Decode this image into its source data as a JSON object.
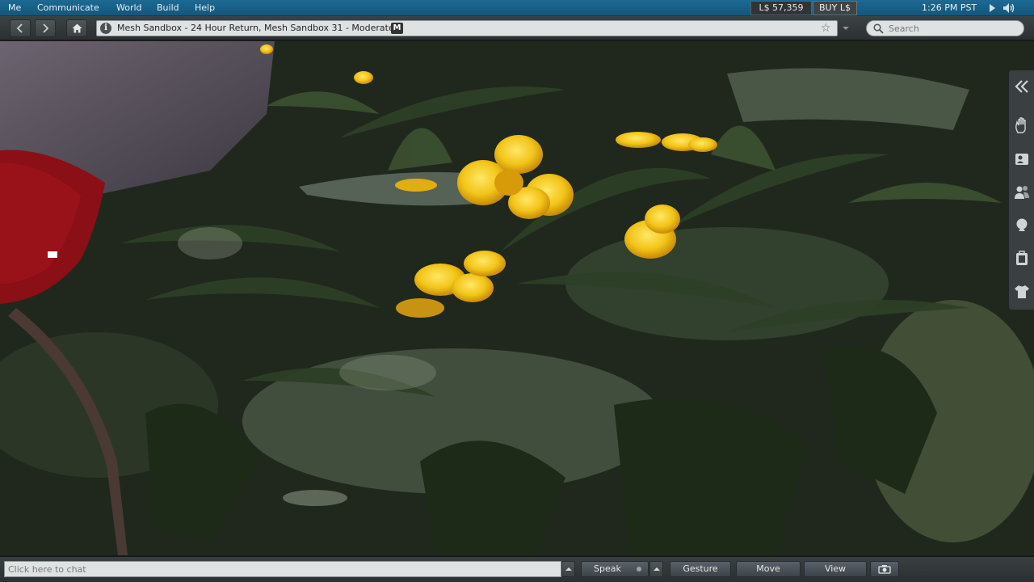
{
  "menubar": {
    "items": [
      "Me",
      "Communicate",
      "World",
      "Build",
      "Help"
    ],
    "balance": "L$ 57,359",
    "buy_label": "BUY L$",
    "time": "1:26 PM PST"
  },
  "navbar": {
    "location": "Mesh Sandbox - 24 Hour Return, Mesh Sandbox 31 - Moderate",
    "rating_badge": "M",
    "search_placeholder": "Search"
  },
  "sidebar": {
    "icons": [
      "collapse-icon",
      "gesture-hand-icon",
      "profile-icon",
      "people-icon",
      "places-icon",
      "inventory-icon",
      "appearance-icon"
    ]
  },
  "bottombar": {
    "chat_placeholder": "Click here to chat",
    "speak_label": "Speak",
    "gesture_label": "Gesture",
    "move_label": "Move",
    "view_label": "View",
    "snapshot_icon": "camera-icon"
  },
  "colors": {
    "menubar": "#1d6a93",
    "toolbar": "#2b3032",
    "flower_yellow": "#f2c418",
    "red_object": "#8a0f16"
  }
}
